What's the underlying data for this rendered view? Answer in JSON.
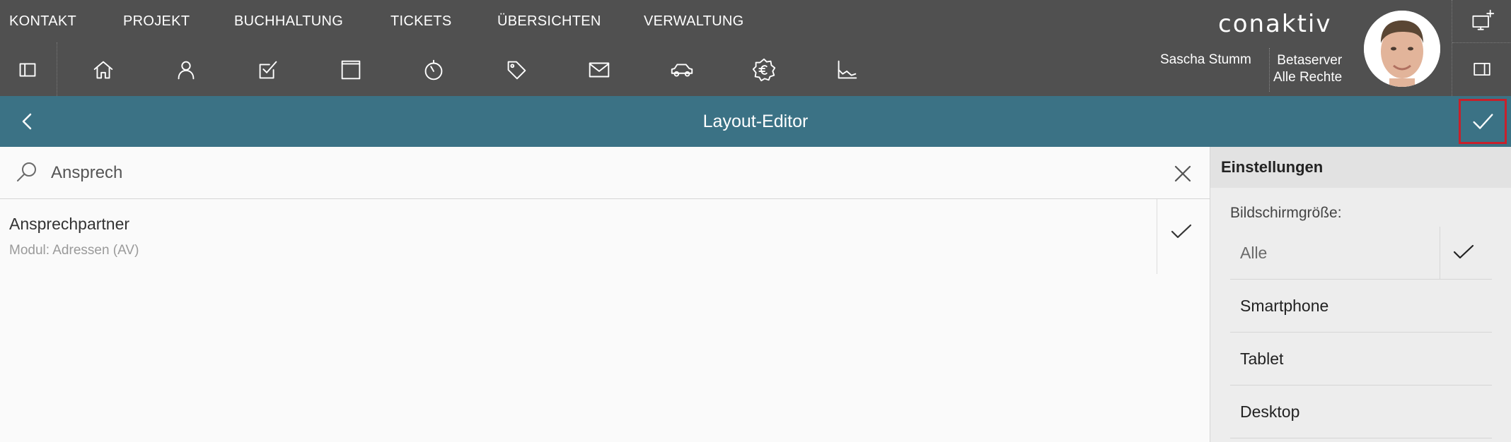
{
  "menu": {
    "items": [
      "KONTAKT",
      "PROJEKT",
      "BUCHHALTUNG",
      "TICKETS",
      "ÜBERSICHTEN",
      "VERWALTUNG"
    ]
  },
  "toolbar": {
    "icons": [
      "sidebar-toggle-icon",
      "home-icon",
      "person-icon",
      "task-check-icon",
      "calendar-square-icon",
      "stopwatch-icon",
      "tag-icon",
      "mail-icon",
      "car-icon",
      "euro-badge-icon",
      "chart-icon"
    ]
  },
  "brand": {
    "logo_text": "conaktiv"
  },
  "user": {
    "name": "Sascha Stumm",
    "server": "Betaserver",
    "rights": "Alle Rechte"
  },
  "titlebar": {
    "title": "Layout-Editor",
    "accent_color": "#3b7285",
    "highlight_color": "#c8202b"
  },
  "search": {
    "value": "Ansprech",
    "placeholder": ""
  },
  "results": [
    {
      "title": "Ansprechpartner",
      "subtitle": "Modul: Adressen (AV)",
      "selected": true
    }
  ],
  "settings": {
    "title": "Einstellungen",
    "screen_size_label": "Bildschirmgröße:",
    "options": [
      {
        "label": "Alle",
        "selected": true
      },
      {
        "label": "Smartphone",
        "selected": false
      },
      {
        "label": "Tablet",
        "selected": false
      },
      {
        "label": "Desktop",
        "selected": false
      }
    ]
  }
}
